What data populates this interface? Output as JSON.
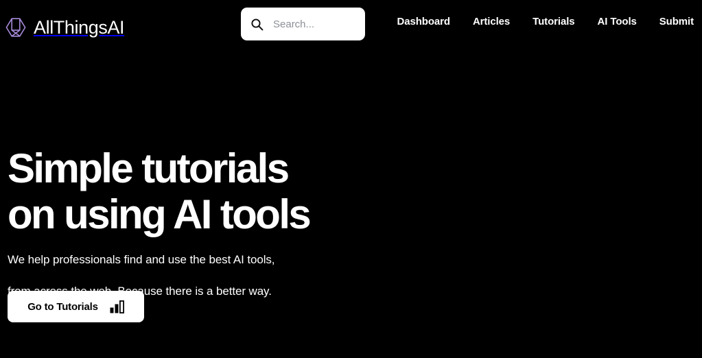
{
  "page": {
    "background_color": "#000000",
    "accent_color": "#a78bda",
    "text_color": "#ffffff"
  },
  "header": {
    "brand": {
      "logo_icon": "cube-logo-icon",
      "name": "AllThingsAI"
    },
    "search": {
      "icon": "search-icon",
      "value": "",
      "placeholder": "Search..."
    },
    "nav": [
      {
        "label": "Dashboard"
      },
      {
        "label": "Articles"
      },
      {
        "label": "Tutorials"
      },
      {
        "label": "AI Tools"
      },
      {
        "label": "Submit"
      }
    ]
  },
  "hero": {
    "title_line1": "Simple tutorials",
    "title_line2": "on using AI tools",
    "subtitle_line1": "We help professionals find and use the best AI tools,",
    "subtitle_line2": "from across the web. Because there is a better way.",
    "cta": {
      "label": "Go to Tutorials",
      "icon": "bar-chart-icon"
    }
  }
}
